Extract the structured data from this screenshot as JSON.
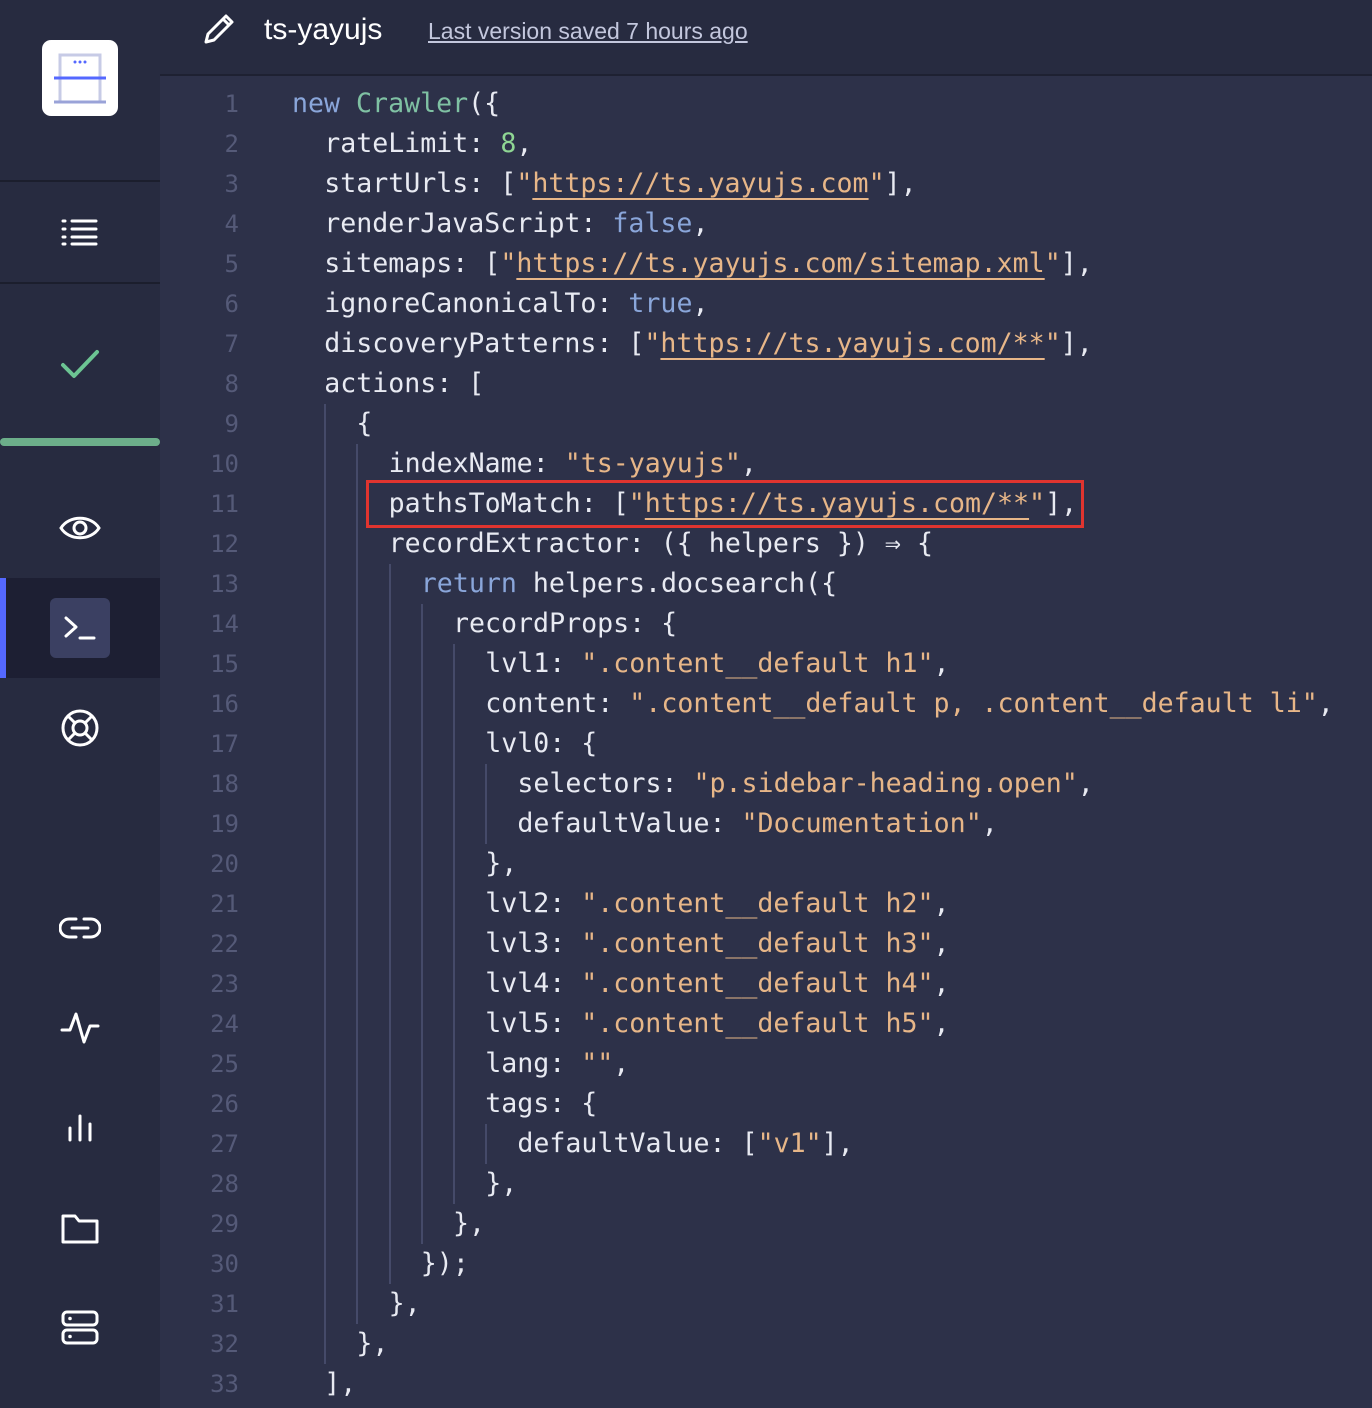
{
  "app": {
    "title": "ts-yayujs",
    "saved_text": "Last version saved 7 hours ago"
  },
  "sidebar": {
    "items": [
      {
        "name": "list-icon"
      },
      {
        "name": "check-icon"
      },
      {
        "name": "eye-icon"
      },
      {
        "name": "terminal-icon",
        "active": true
      },
      {
        "name": "lifebuoy-icon"
      },
      {
        "name": "link-icon"
      },
      {
        "name": "activity-icon"
      },
      {
        "name": "bar-chart-icon"
      },
      {
        "name": "folder-icon"
      },
      {
        "name": "server-icon"
      }
    ],
    "progress": 1.0
  },
  "colors": {
    "keyword": "#8aa6da",
    "class": "#7fc1a3",
    "number": "#8fd694",
    "string": "#e7b688",
    "accent": "#5468ff",
    "highlight": "#e0342f"
  },
  "editor": {
    "lines": [
      {
        "n": "1",
        "indent": 0,
        "tokens": [
          {
            "t": "new ",
            "c": "kw"
          },
          {
            "t": "Crawler",
            "c": "cls"
          },
          {
            "t": "({"
          }
        ]
      },
      {
        "n": "2",
        "indent": 1,
        "tokens": [
          {
            "t": "rateLimit: "
          },
          {
            "t": "8",
            "c": "num"
          },
          {
            "t": ","
          }
        ]
      },
      {
        "n": "3",
        "indent": 1,
        "tokens": [
          {
            "t": "startUrls: ["
          },
          {
            "t": "\"",
            "c": "str"
          },
          {
            "t": "https://ts.yayujs.com",
            "c": "url"
          },
          {
            "t": "\"",
            "c": "str"
          },
          {
            "t": "],"
          }
        ]
      },
      {
        "n": "4",
        "indent": 1,
        "tokens": [
          {
            "t": "renderJavaScript: "
          },
          {
            "t": "false",
            "c": "kw"
          },
          {
            "t": ","
          }
        ]
      },
      {
        "n": "5",
        "indent": 1,
        "tokens": [
          {
            "t": "sitemaps: ["
          },
          {
            "t": "\"",
            "c": "str"
          },
          {
            "t": "https://ts.yayujs.com/sitemap.xml",
            "c": "url"
          },
          {
            "t": "\"",
            "c": "str"
          },
          {
            "t": "],"
          }
        ]
      },
      {
        "n": "6",
        "indent": 1,
        "tokens": [
          {
            "t": "ignoreCanonicalTo: "
          },
          {
            "t": "true",
            "c": "kw"
          },
          {
            "t": ","
          }
        ]
      },
      {
        "n": "7",
        "indent": 1,
        "tokens": [
          {
            "t": "discoveryPatterns: ["
          },
          {
            "t": "\"",
            "c": "str"
          },
          {
            "t": "https://ts.yayujs.com/**",
            "c": "url"
          },
          {
            "t": "\"",
            "c": "str"
          },
          {
            "t": "],"
          }
        ]
      },
      {
        "n": "8",
        "indent": 1,
        "tokens": [
          {
            "t": "actions: ["
          }
        ]
      },
      {
        "n": "9",
        "indent": 2,
        "tokens": [
          {
            "t": "{"
          }
        ]
      },
      {
        "n": "10",
        "indent": 3,
        "tokens": [
          {
            "t": "indexName: "
          },
          {
            "t": "\"ts-yayujs\"",
            "c": "str"
          },
          {
            "t": ","
          }
        ]
      },
      {
        "n": "11",
        "indent": 3,
        "tokens": [
          {
            "t": "pathsToMatch: ["
          },
          {
            "t": "\"",
            "c": "str"
          },
          {
            "t": "https://ts.yayujs.com/**",
            "c": "url"
          },
          {
            "t": "\"",
            "c": "str"
          },
          {
            "t": "],"
          }
        ]
      },
      {
        "n": "12",
        "indent": 3,
        "tokens": [
          {
            "t": "recordExtractor: ({ helpers }) ⇒ {"
          }
        ]
      },
      {
        "n": "13",
        "indent": 4,
        "tokens": [
          {
            "t": "return ",
            "c": "kw"
          },
          {
            "t": "helpers.docsearch({"
          }
        ]
      },
      {
        "n": "14",
        "indent": 5,
        "tokens": [
          {
            "t": "recordProps: {"
          }
        ]
      },
      {
        "n": "15",
        "indent": 6,
        "tokens": [
          {
            "t": "lvl1: "
          },
          {
            "t": "\".content__default h1\"",
            "c": "str"
          },
          {
            "t": ","
          }
        ]
      },
      {
        "n": "16",
        "indent": 6,
        "tokens": [
          {
            "t": "content: "
          },
          {
            "t": "\".content__default p, .content__default li\"",
            "c": "str"
          },
          {
            "t": ","
          }
        ]
      },
      {
        "n": "17",
        "indent": 6,
        "tokens": [
          {
            "t": "lvl0: {"
          }
        ]
      },
      {
        "n": "18",
        "indent": 7,
        "tokens": [
          {
            "t": "selectors: "
          },
          {
            "t": "\"p.sidebar-heading.open\"",
            "c": "str"
          },
          {
            "t": ","
          }
        ]
      },
      {
        "n": "19",
        "indent": 7,
        "tokens": [
          {
            "t": "defaultValue: "
          },
          {
            "t": "\"Documentation\"",
            "c": "str"
          },
          {
            "t": ","
          }
        ]
      },
      {
        "n": "20",
        "indent": 6,
        "tokens": [
          {
            "t": "},"
          }
        ]
      },
      {
        "n": "21",
        "indent": 6,
        "tokens": [
          {
            "t": "lvl2: "
          },
          {
            "t": "\".content__default h2\"",
            "c": "str"
          },
          {
            "t": ","
          }
        ]
      },
      {
        "n": "22",
        "indent": 6,
        "tokens": [
          {
            "t": "lvl3: "
          },
          {
            "t": "\".content__default h3\"",
            "c": "str"
          },
          {
            "t": ","
          }
        ]
      },
      {
        "n": "23",
        "indent": 6,
        "tokens": [
          {
            "t": "lvl4: "
          },
          {
            "t": "\".content__default h4\"",
            "c": "str"
          },
          {
            "t": ","
          }
        ]
      },
      {
        "n": "24",
        "indent": 6,
        "tokens": [
          {
            "t": "lvl5: "
          },
          {
            "t": "\".content__default h5\"",
            "c": "str"
          },
          {
            "t": ","
          }
        ]
      },
      {
        "n": "25",
        "indent": 6,
        "tokens": [
          {
            "t": "lang: "
          },
          {
            "t": "\"\"",
            "c": "str"
          },
          {
            "t": ","
          }
        ]
      },
      {
        "n": "26",
        "indent": 6,
        "tokens": [
          {
            "t": "tags: {"
          }
        ]
      },
      {
        "n": "27",
        "indent": 7,
        "tokens": [
          {
            "t": "defaultValue: ["
          },
          {
            "t": "\"v1\"",
            "c": "str"
          },
          {
            "t": "],"
          }
        ]
      },
      {
        "n": "28",
        "indent": 6,
        "tokens": [
          {
            "t": "},"
          }
        ]
      },
      {
        "n": "29",
        "indent": 5,
        "tokens": [
          {
            "t": "},"
          }
        ]
      },
      {
        "n": "30",
        "indent": 4,
        "tokens": [
          {
            "t": "});"
          }
        ]
      },
      {
        "n": "31",
        "indent": 3,
        "tokens": [
          {
            "t": "},"
          }
        ]
      },
      {
        "n": "32",
        "indent": 2,
        "tokens": [
          {
            "t": "},"
          }
        ]
      },
      {
        "n": "33",
        "indent": 1,
        "tokens": [
          {
            "t": "],"
          }
        ]
      }
    ]
  }
}
